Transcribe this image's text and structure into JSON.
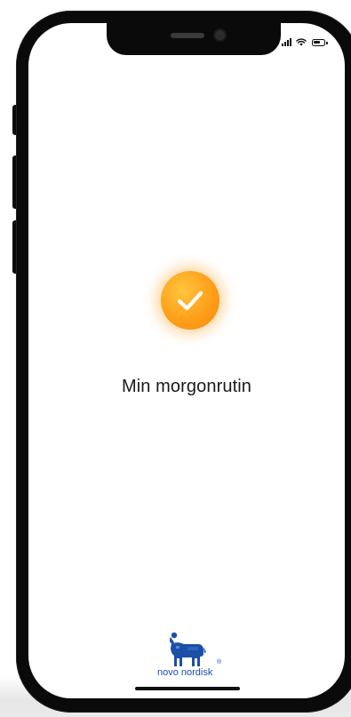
{
  "routine": {
    "title": "Min morgonrutin",
    "status_icon": "checkmark-icon",
    "status_color": "#FF9F1A"
  },
  "brand": {
    "name": "novo nordisk",
    "registered_mark": "®",
    "logo_icon": "apis-bull-logo",
    "color": "#1B4FA8"
  },
  "status_bar": {
    "signal_icon": "cellular-signal-icon",
    "wifi_icon": "wifi-icon",
    "battery_icon": "battery-icon"
  }
}
